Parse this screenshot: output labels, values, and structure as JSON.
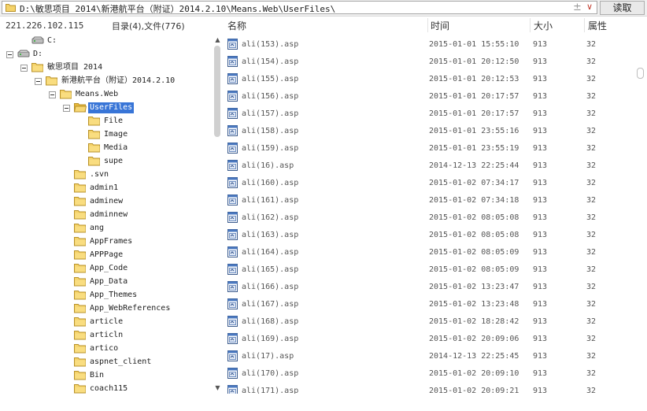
{
  "address": {
    "path": "D:\\敏思项目 2014\\新港航平台（附证）2014.2.10\\Means.Web\\UserFiles\\",
    "plus_glyph": "±",
    "dropdown_glyph": "∨",
    "read_button": "读取"
  },
  "status": {
    "ip": "221.226.102.115",
    "counts": "目录(4),文件(776)"
  },
  "columns": {
    "name": "名称",
    "time": "时间",
    "size": "大小",
    "attr": "属性"
  },
  "tree": [
    {
      "label": "C:",
      "kind": "drive",
      "expander": false
    },
    {
      "label": "D:",
      "kind": "drive",
      "expander": true
    },
    {
      "label": "敏思项目 2014",
      "kind": "folder",
      "expander": true
    },
    {
      "label": "新港航平台（附证）2014.2.10",
      "kind": "folder",
      "expander": true
    },
    {
      "label": "Means.Web",
      "kind": "folder",
      "expander": true
    },
    {
      "label": "UserFiles",
      "kind": "folder-open",
      "expander": true,
      "selected": true
    },
    {
      "label": "File",
      "kind": "folder"
    },
    {
      "label": "Image",
      "kind": "folder"
    },
    {
      "label": "Media",
      "kind": "folder"
    },
    {
      "label": "supe",
      "kind": "folder"
    },
    {
      "label": ".svn",
      "kind": "folder"
    },
    {
      "label": "admin1",
      "kind": "folder"
    },
    {
      "label": "adminew",
      "kind": "folder"
    },
    {
      "label": "adminnew",
      "kind": "folder"
    },
    {
      "label": "ang",
      "kind": "folder"
    },
    {
      "label": "AppFrames",
      "kind": "folder"
    },
    {
      "label": "APPPage",
      "kind": "folder"
    },
    {
      "label": "App_Code",
      "kind": "folder"
    },
    {
      "label": "App_Data",
      "kind": "folder"
    },
    {
      "label": "App_Themes",
      "kind": "folder"
    },
    {
      "label": "App_WebReferences",
      "kind": "folder"
    },
    {
      "label": "article",
      "kind": "folder"
    },
    {
      "label": "articln",
      "kind": "folder"
    },
    {
      "label": "artico",
      "kind": "folder"
    },
    {
      "label": "aspnet_client",
      "kind": "folder"
    },
    {
      "label": "Bin",
      "kind": "folder"
    },
    {
      "label": "coach115",
      "kind": "folder"
    }
  ],
  "files": [
    {
      "name": "ali(153).asp",
      "time": "2015-01-01 15:55:10",
      "size": "913",
      "attr": "32"
    },
    {
      "name": "ali(154).asp",
      "time": "2015-01-01 20:12:50",
      "size": "913",
      "attr": "32"
    },
    {
      "name": "ali(155).asp",
      "time": "2015-01-01 20:12:53",
      "size": "913",
      "attr": "32"
    },
    {
      "name": "ali(156).asp",
      "time": "2015-01-01 20:17:57",
      "size": "913",
      "attr": "32"
    },
    {
      "name": "ali(157).asp",
      "time": "2015-01-01 20:17:57",
      "size": "913",
      "attr": "32"
    },
    {
      "name": "ali(158).asp",
      "time": "2015-01-01 23:55:16",
      "size": "913",
      "attr": "32"
    },
    {
      "name": "ali(159).asp",
      "time": "2015-01-01 23:55:19",
      "size": "913",
      "attr": "32"
    },
    {
      "name": "ali(16).asp",
      "time": "2014-12-13 22:25:44",
      "size": "913",
      "attr": "32"
    },
    {
      "name": "ali(160).asp",
      "time": "2015-01-02 07:34:17",
      "size": "913",
      "attr": "32"
    },
    {
      "name": "ali(161).asp",
      "time": "2015-01-02 07:34:18",
      "size": "913",
      "attr": "32"
    },
    {
      "name": "ali(162).asp",
      "time": "2015-01-02 08:05:08",
      "size": "913",
      "attr": "32"
    },
    {
      "name": "ali(163).asp",
      "time": "2015-01-02 08:05:08",
      "size": "913",
      "attr": "32"
    },
    {
      "name": "ali(164).asp",
      "time": "2015-01-02 08:05:09",
      "size": "913",
      "attr": "32"
    },
    {
      "name": "ali(165).asp",
      "time": "2015-01-02 08:05:09",
      "size": "913",
      "attr": "32"
    },
    {
      "name": "ali(166).asp",
      "time": "2015-01-02 13:23:47",
      "size": "913",
      "attr": "32"
    },
    {
      "name": "ali(167).asp",
      "time": "2015-01-02 13:23:48",
      "size": "913",
      "attr": "32"
    },
    {
      "name": "ali(168).asp",
      "time": "2015-01-02 18:28:42",
      "size": "913",
      "attr": "32"
    },
    {
      "name": "ali(169).asp",
      "time": "2015-01-02 20:09:06",
      "size": "913",
      "attr": "32"
    },
    {
      "name": "ali(17).asp",
      "time": "2014-12-13 22:25:45",
      "size": "913",
      "attr": "32"
    },
    {
      "name": "ali(170).asp",
      "time": "2015-01-02 20:09:10",
      "size": "913",
      "attr": "32"
    },
    {
      "name": "ali(171).asp",
      "time": "2015-01-02 20:09:21",
      "size": "913",
      "attr": "32"
    }
  ]
}
